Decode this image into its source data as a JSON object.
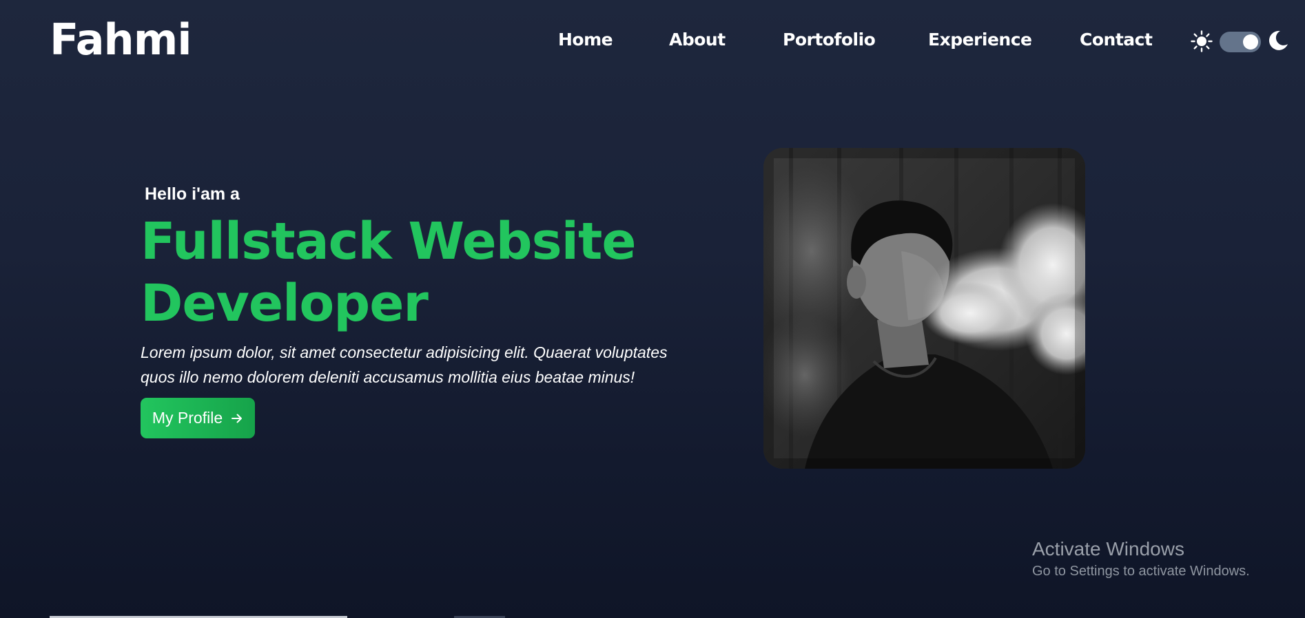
{
  "header": {
    "logo": "Fahmi",
    "nav": [
      {
        "label": "Home"
      },
      {
        "label": "About"
      },
      {
        "label": "Portofolio"
      },
      {
        "label": "Experience"
      },
      {
        "label": "Contact"
      }
    ],
    "theme_toggle": {
      "sun_icon": "sun-icon",
      "moon_icon": "moon-icon",
      "state": "dark"
    }
  },
  "hero": {
    "greeting": "Hello i'am a",
    "title_line1": "Fullstack Website",
    "title_line2": "Developer",
    "description_line1": "Lorem ipsum dolor, sit amet consectetur adipisicing elit. Quaerat voluptates",
    "description_line2": "quos illo nemo dolorem deleniti accusamus mollitia eius beatae minus!",
    "button_label": "My Profile",
    "button_icon": "arrow-right-icon",
    "photo": "profile-photo"
  },
  "watermark": {
    "title": "Activate Windows",
    "subtitle": "Go to Settings to activate Windows."
  },
  "colors": {
    "accent": "#22c55e",
    "background_top": "#1e273d",
    "background_bottom": "#0f1527",
    "toggle_track": "#64748b"
  }
}
